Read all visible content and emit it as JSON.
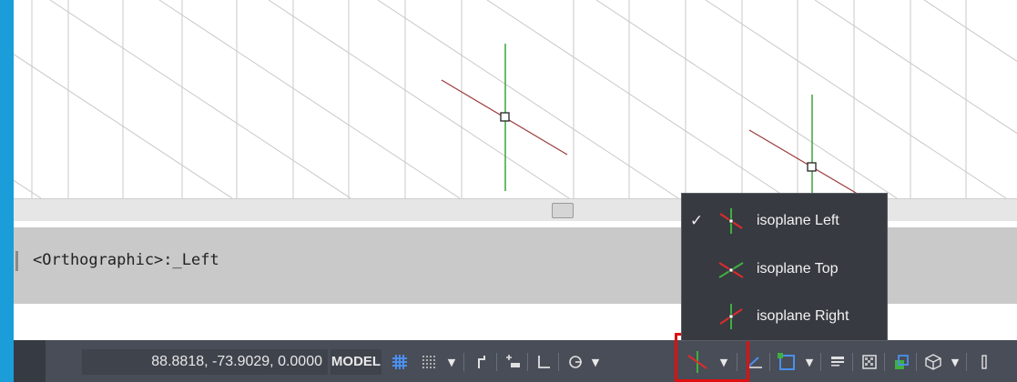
{
  "command_line": {
    "text": "<Orthographic>:_Left"
  },
  "status_bar": {
    "coordinates": "88.8818, -73.9029, 0.0000",
    "model_label": "MODEL",
    "icons": [
      "grid-icon",
      "snap-grid-icon",
      "infer-constraints-icon",
      "dynamic-input-icon",
      "ortho-icon",
      "polar-icon",
      "isoplane-left-icon",
      "dynamic-ucs-icon",
      "object-snap-icon",
      "lineweight-icon",
      "transparency-icon",
      "selection-cycling-icon",
      "3d-object-snap-icon"
    ]
  },
  "isoplane_menu": {
    "items": [
      {
        "label": "isoplane Left",
        "checked": true,
        "icon": "isoplane-left-icon"
      },
      {
        "label": "isoplane Top",
        "checked": false,
        "icon": "isoplane-top-icon"
      },
      {
        "label": "isoplane Right",
        "checked": false,
        "icon": "isoplane-right-icon"
      }
    ],
    "check_mark": "✓"
  },
  "colors": {
    "accent_frame": "#1b9dd9",
    "highlight": "#e01010",
    "status_bg": "#494d57",
    "menu_bg": "#373a41"
  }
}
